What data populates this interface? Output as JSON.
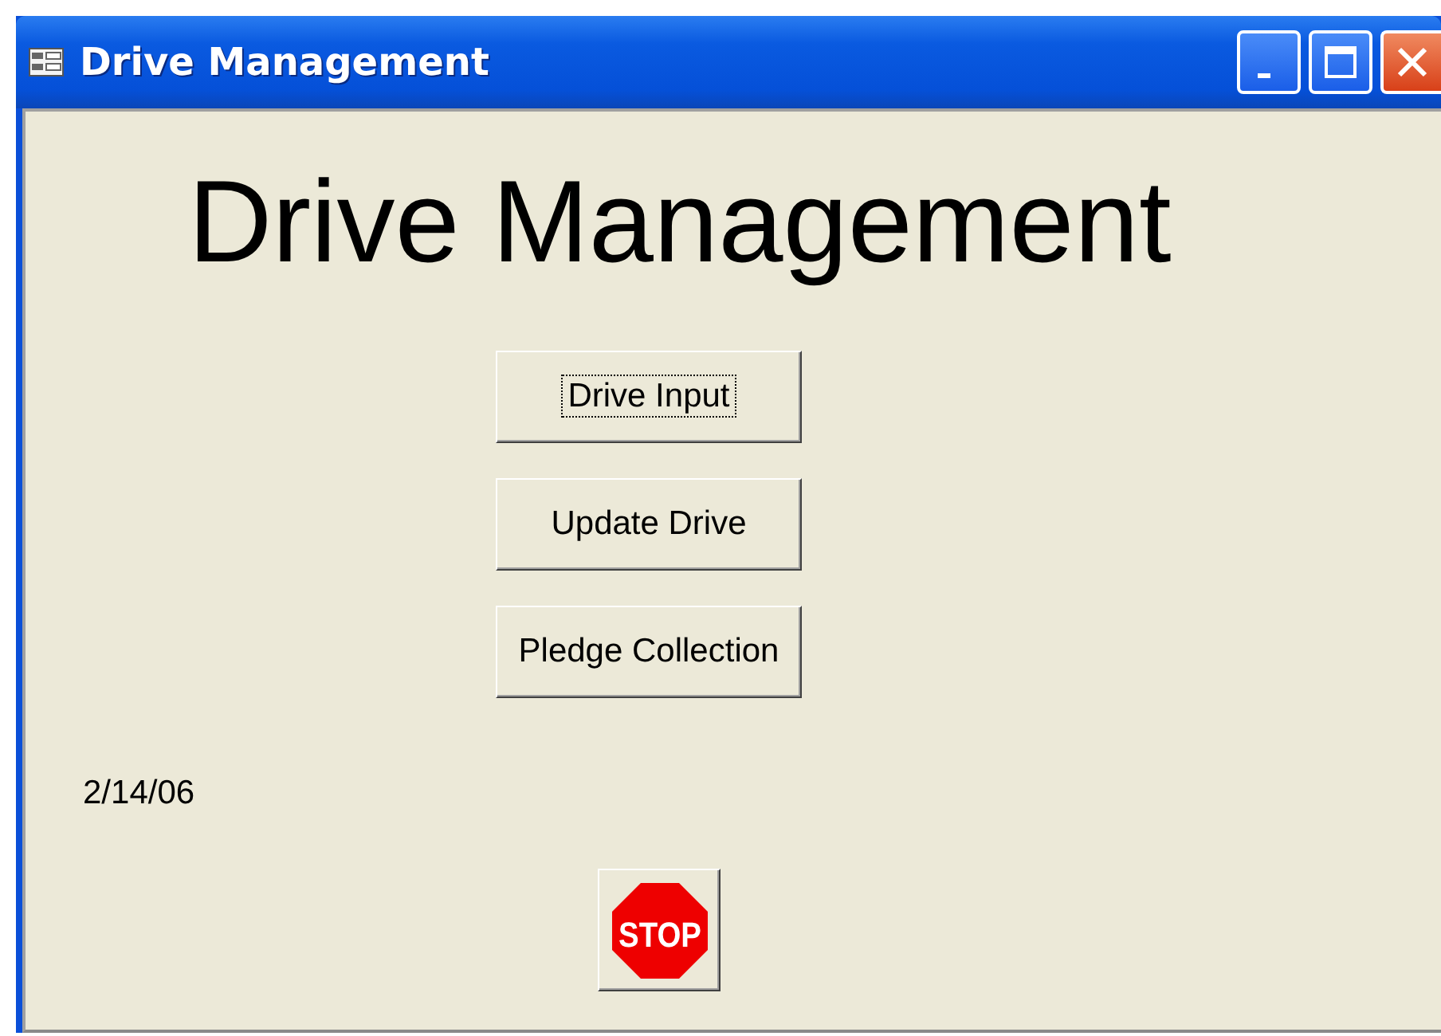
{
  "window": {
    "title": "Drive Management"
  },
  "heading": "Drive Management",
  "buttons": [
    {
      "label": "Drive Input",
      "focused": true
    },
    {
      "label": "Update Drive",
      "focused": false
    },
    {
      "label": "Pledge Collection",
      "focused": false
    }
  ],
  "date": "2/14/06",
  "stop_button": {
    "label": "STOP"
  }
}
